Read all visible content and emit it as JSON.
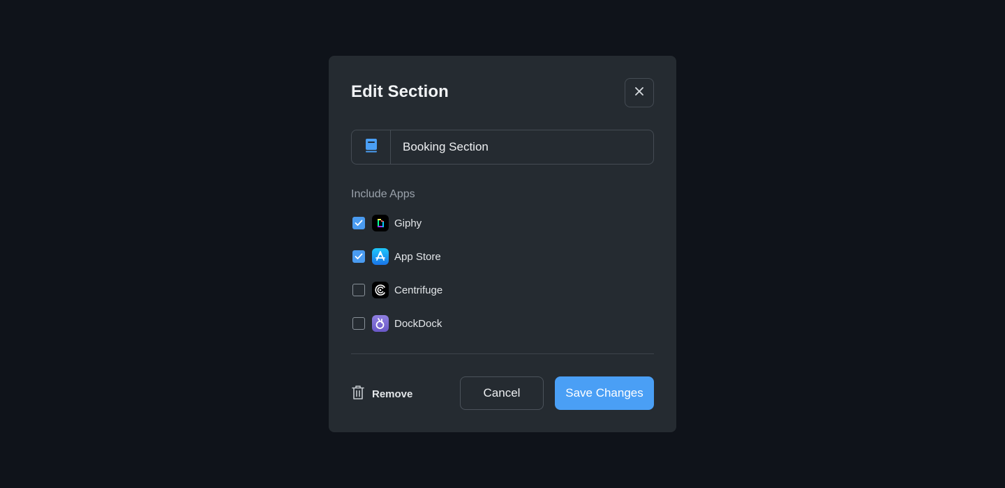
{
  "modal": {
    "title": "Edit Section",
    "close_icon": "close-icon"
  },
  "name_field": {
    "icon": "book-icon",
    "value": "Booking Section"
  },
  "apps": {
    "label": "Include Apps",
    "items": [
      {
        "name": "Giphy",
        "checked": true,
        "icon": "giphy-icon"
      },
      {
        "name": "App Store",
        "checked": true,
        "icon": "app-store-icon"
      },
      {
        "name": "Centrifuge",
        "checked": false,
        "icon": "centrifuge-icon"
      },
      {
        "name": "DockDock",
        "checked": false,
        "icon": "dockdock-icon"
      }
    ]
  },
  "footer": {
    "remove_label": "Remove",
    "remove_icon": "trash-icon",
    "cancel_label": "Cancel",
    "save_label": "Save Changes"
  },
  "colors": {
    "background": "#0f131a",
    "modal": "#252b31",
    "accent": "#4a9ff5",
    "checkbox_checked": "#4a9bf0"
  }
}
